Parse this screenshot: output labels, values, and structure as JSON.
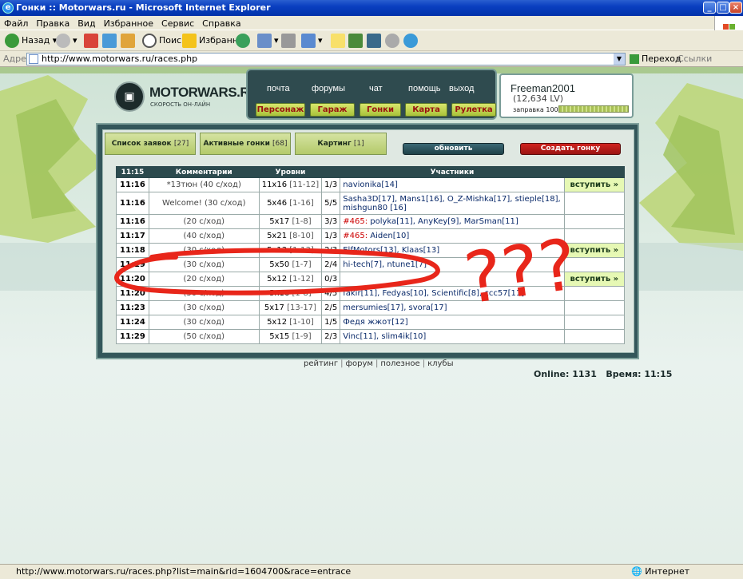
{
  "window": {
    "title": "Гонки :: Motorwars.ru - Microsoft Internet Explorer"
  },
  "menu": [
    "Файл",
    "Правка",
    "Вид",
    "Избранное",
    "Сервис",
    "Справка"
  ],
  "toolbar": {
    "back": "Назад",
    "search": "Поиск",
    "favorites": "Избранное"
  },
  "address": {
    "label": "Адрес:",
    "url": "http://www.motorwars.ru/races.php",
    "go": "Переход",
    "links": "Ссылки"
  },
  "site": {
    "logo_name": "MOTORWARS.RU",
    "logo_slogan": "СКОРОСТЬ ОН-ЛАЙН",
    "top_links": [
      "почта",
      "форумы",
      "чат",
      "помощь",
      "выход"
    ],
    "nav_buttons": [
      "Персонаж",
      "Гараж",
      "Гонки",
      "Карта",
      "Рулетка"
    ]
  },
  "user": {
    "name": "Freeman2001",
    "lv": "(12,634 LV)",
    "fuel_label": "заправка 100%",
    "fuel_level": 1.0
  },
  "tabs": [
    {
      "label": "Список заявок",
      "count": "[27]"
    },
    {
      "label": "Активные гонки",
      "count": "[68]"
    },
    {
      "label": "Картинг",
      "count": "[1]"
    }
  ],
  "refresh_label": "обновить",
  "create_label": "Создать гонку",
  "table": {
    "headers": [
      "11:15",
      "Комментарии",
      "Уровни",
      "",
      "Участники",
      ""
    ],
    "rows": [
      {
        "time": "11:16",
        "comment": "*13тюн (40 с/ход)",
        "level": "11x16",
        "range": "[11-12]",
        "slots": "1/3",
        "prefix": "",
        "participants": "navionika[14]",
        "action": "вступить »"
      },
      {
        "time": "11:16",
        "comment": "Welcome! (30 с/ход)",
        "level": "5x46",
        "range": "[1-16]",
        "slots": "5/5",
        "prefix": "",
        "participants": "Sasha3D[17], Mans1[16], O_Z-Mishka[17], stieple[18], mishgun80 [16]",
        "action": ""
      },
      {
        "time": "11:16",
        "comment": "(20 с/ход)",
        "level": "5x17",
        "range": "[1-8]",
        "slots": "3/3",
        "prefix": "#465:",
        "participants": "polyka[11], AnyKey[9], MarSman[11]",
        "action": ""
      },
      {
        "time": "11:17",
        "comment": "(40 с/ход)",
        "level": "5x21",
        "range": "[8-10]",
        "slots": "1/3",
        "prefix": "#465:",
        "participants": "Aiden[10]",
        "action": ""
      },
      {
        "time": "11:18",
        "comment": "(30 с/ход)",
        "level": "5x13",
        "range": "[1-13]",
        "slots": "2/3",
        "prefix": "",
        "participants": "ElfMotors[13], Klaas[13]",
        "action": "вступить »"
      },
      {
        "time": "11:19",
        "comment": "(30 с/ход)",
        "level": "5x50",
        "range": "[1-7]",
        "slots": "2/4",
        "prefix": "",
        "participants": "hi-tech[7], ntune1[7]",
        "action": ""
      },
      {
        "time": "11:20",
        "comment": "(20 с/ход)",
        "level": "5x12",
        "range": "[1-12]",
        "slots": "0/3",
        "prefix": "",
        "participants": "",
        "action": "вступить »"
      },
      {
        "time": "11:20",
        "comment": "(30 с/ход)",
        "level": "5x16",
        "range": "[1-8]",
        "slots": "4/5",
        "prefix": "",
        "participants": "fakir[11], Fedyas[10], Scientific[8], ccc57[11]",
        "action": ""
      },
      {
        "time": "11:23",
        "comment": "(30 с/ход)",
        "level": "5x17",
        "range": "[13-17]",
        "slots": "2/5",
        "prefix": "",
        "participants": "mersumies[17], svora[17]",
        "action": ""
      },
      {
        "time": "11:24",
        "comment": "(30 с/ход)",
        "level": "5x12",
        "range": "[1-10]",
        "slots": "1/5",
        "prefix": "",
        "participants": "Федя жжот[12]",
        "action": ""
      },
      {
        "time": "11:29",
        "comment": "(50 с/ход)",
        "level": "5x15",
        "range": "[1-9]",
        "slots": "2/3",
        "prefix": "",
        "participants": "Vinc[11], slim4ik[10]",
        "action": ""
      }
    ]
  },
  "footer": {
    "links": [
      "рейтинг",
      "форум",
      "полезное",
      "клубы"
    ],
    "online": "Online: 1131",
    "time": "Время: 11:15"
  },
  "annotation": {
    "text": "???",
    "color": "#e8261a"
  },
  "status": {
    "url": "http://www.motorwars.ru/races.php?list=main&rid=1604700&race=entrace",
    "zone": "Интернет"
  }
}
